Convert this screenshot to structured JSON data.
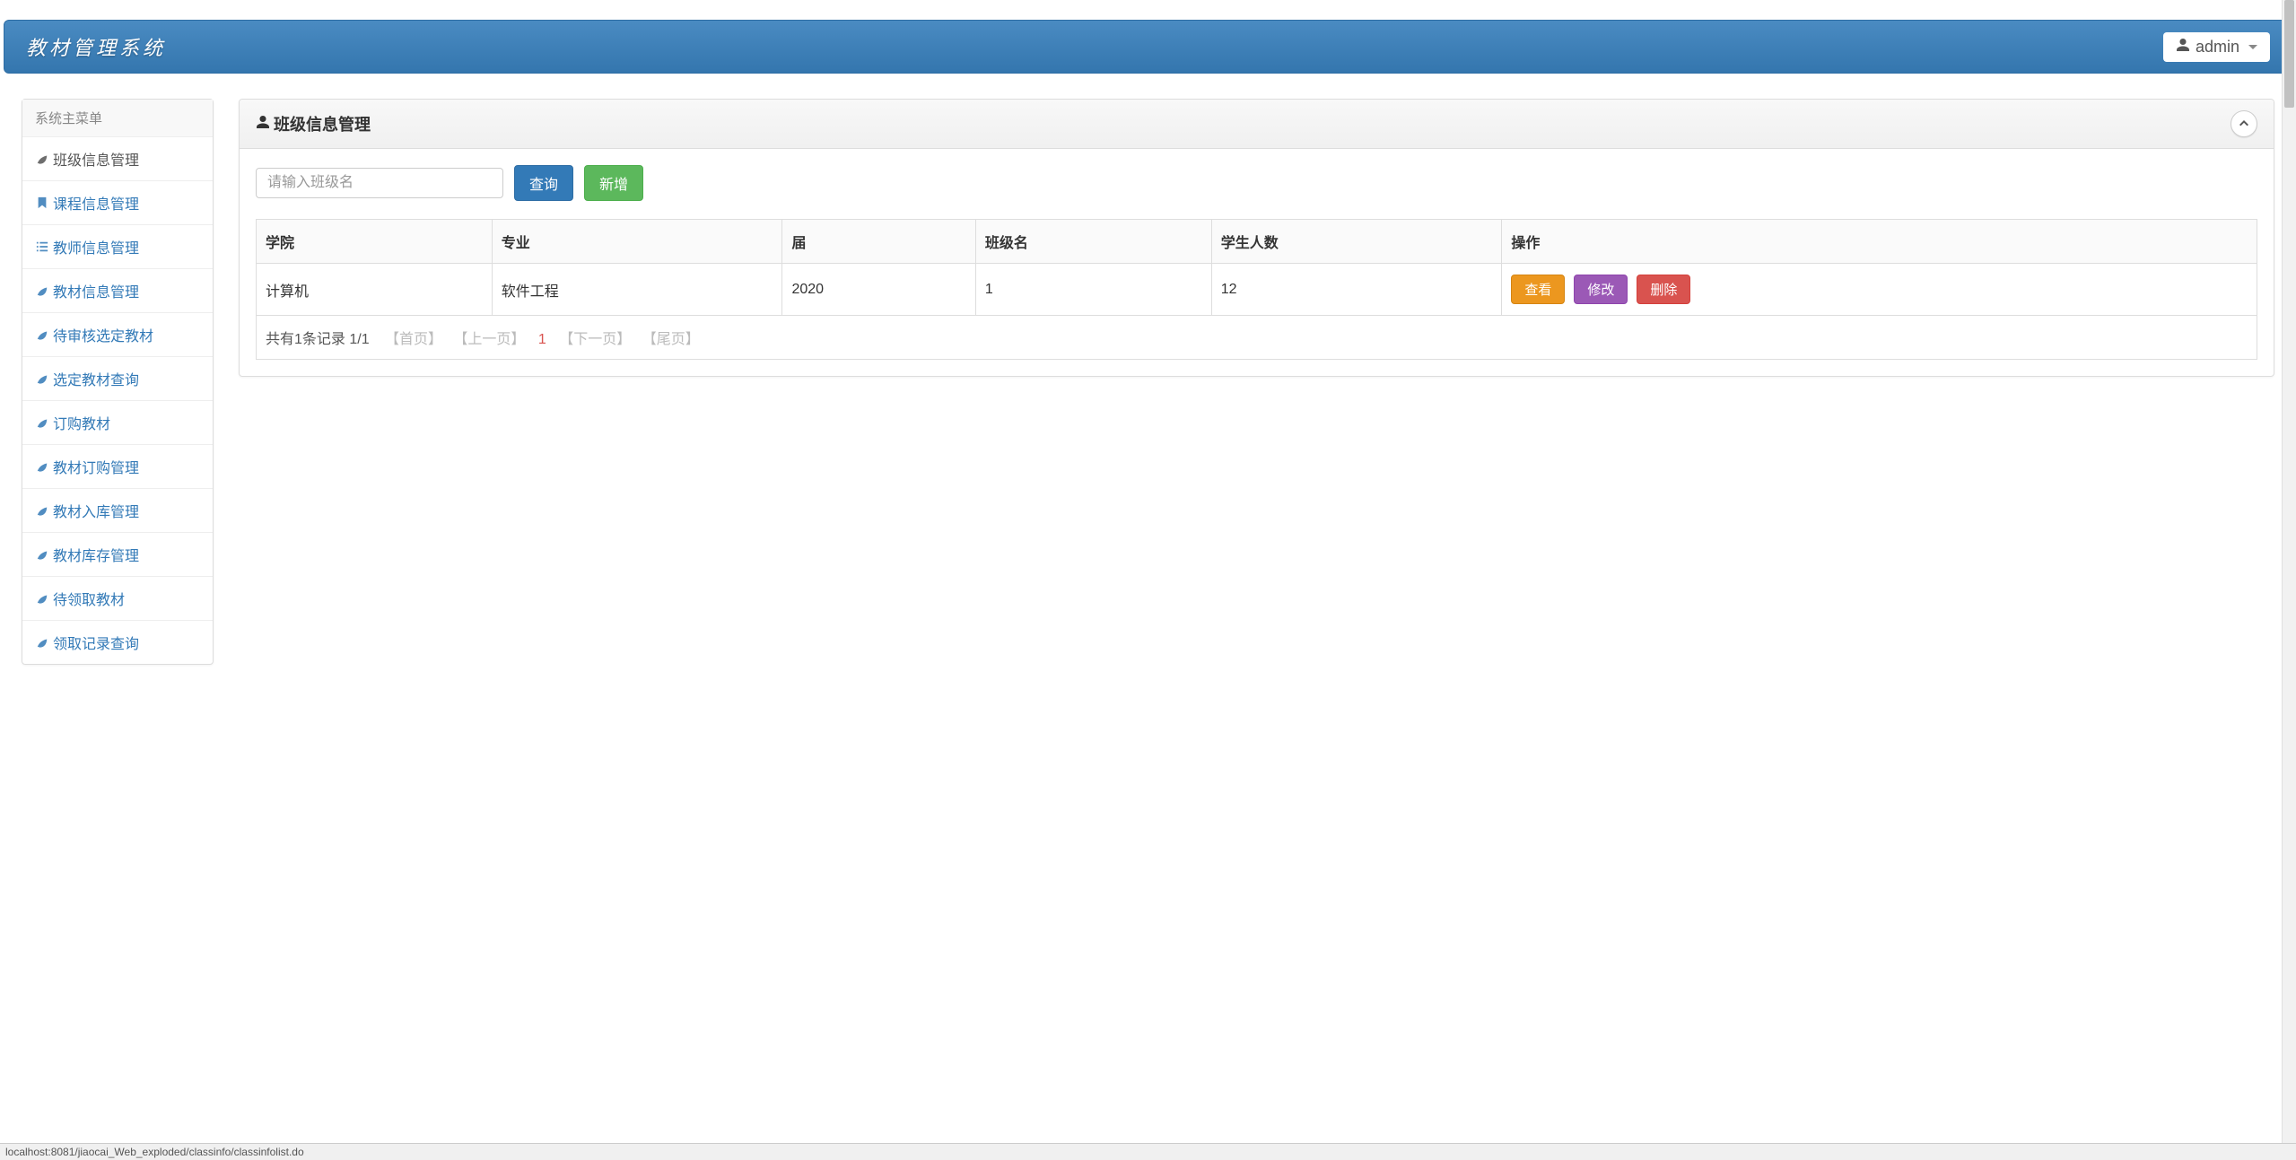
{
  "brand": "教材管理系统",
  "user": {
    "name": "admin"
  },
  "sidebar": {
    "header": "系统主菜单",
    "items": [
      {
        "label": "班级信息管理",
        "icon": "leaf",
        "active": true
      },
      {
        "label": "课程信息管理",
        "icon": "bookmark",
        "active": false
      },
      {
        "label": "教师信息管理",
        "icon": "list",
        "active": false
      },
      {
        "label": "教材信息管理",
        "icon": "leaf",
        "active": false
      },
      {
        "label": "待审核选定教材",
        "icon": "leaf",
        "active": false
      },
      {
        "label": "选定教材查询",
        "icon": "leaf",
        "active": false
      },
      {
        "label": "订购教材",
        "icon": "leaf",
        "active": false
      },
      {
        "label": "教材订购管理",
        "icon": "leaf",
        "active": false
      },
      {
        "label": "教材入库管理",
        "icon": "leaf",
        "active": false
      },
      {
        "label": "教材库存管理",
        "icon": "leaf",
        "active": false
      },
      {
        "label": "待领取教材",
        "icon": "leaf",
        "active": false
      },
      {
        "label": "领取记录查询",
        "icon": "leaf",
        "active": false
      }
    ]
  },
  "panel": {
    "title": "班级信息管理",
    "search_placeholder": "请输入班级名",
    "query_btn": "查询",
    "add_btn": "新增"
  },
  "table": {
    "headers": [
      "学院",
      "专业",
      "届",
      "班级名",
      "学生人数",
      "操作"
    ],
    "rows": [
      {
        "cells": [
          "计算机",
          "软件工程",
          "2020",
          "1",
          "12"
        ]
      }
    ],
    "actions": {
      "view": "查看",
      "edit": "修改",
      "delete": "删除"
    }
  },
  "pagination": {
    "summary": "共有1条记录 1/1",
    "first": "【首页】",
    "prev": "【上一页】",
    "current": "1",
    "next": "【下一页】",
    "last": "【尾页】"
  },
  "status_bar": "localhost:8081/jiaocai_Web_exploded/classinfo/classinfolist.do"
}
